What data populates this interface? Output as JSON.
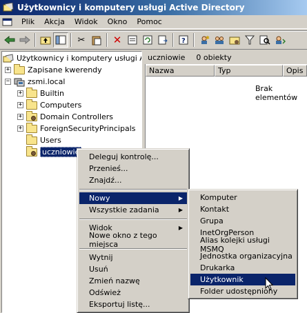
{
  "window": {
    "title": "Użytkownicy i komputery usługi Active Directory"
  },
  "menubar": {
    "items": [
      "Plik",
      "Akcja",
      "Widok",
      "Okno",
      "Pomoc"
    ]
  },
  "toolbar": {
    "icons": [
      "back-arrow-icon",
      "forward-arrow-icon",
      "up-folder-icon",
      "show-hide-tree-icon",
      "cut-icon",
      "paste-icon",
      "delete-icon",
      "properties-icon",
      "refresh-icon",
      "export-list-icon",
      "help-icon",
      "new-user-icon",
      "new-group-icon",
      "new-ou-icon",
      "filter-icon",
      "find-icon",
      "add-to-group-icon"
    ]
  },
  "tree": {
    "root": "Użytkownicy i komputery usługi Active",
    "saved_queries": "Zapisane kwerendy",
    "domain": "zsmi.local",
    "children": [
      "Builtin",
      "Computers",
      "Domain Controllers",
      "ForeignSecurityPrincipals",
      "Users",
      "uczniowie"
    ]
  },
  "right_pane": {
    "header_name": "uczniowie",
    "header_count": "0 obiekty",
    "columns": [
      "Nazwa",
      "Typ",
      "Opis"
    ],
    "empty_message": "Brak elementów"
  },
  "context_menu": {
    "items": [
      "Deleguj kontrolę...",
      "Przenieś...",
      "Znajdź...",
      "Nowy",
      "Wszystkie zadania",
      "Widok",
      "Nowe okno z tego miejsca",
      "Wytnij",
      "Usuń",
      "Zmień nazwę",
      "Odśwież",
      "Eksportuj listę..."
    ]
  },
  "submenu": {
    "items": [
      "Komputer",
      "Kontakt",
      "Grupa",
      "InetOrgPerson",
      "Alias kolejki usługi MSMQ",
      "Jednostka organizacyjna",
      "Drukarka",
      "Użytkownik",
      "Folder udostępniony"
    ]
  },
  "colors": {
    "selection": "#0a246a",
    "face": "#d4d0c8",
    "title_start": "#0a246a",
    "title_end": "#a6caf0"
  }
}
